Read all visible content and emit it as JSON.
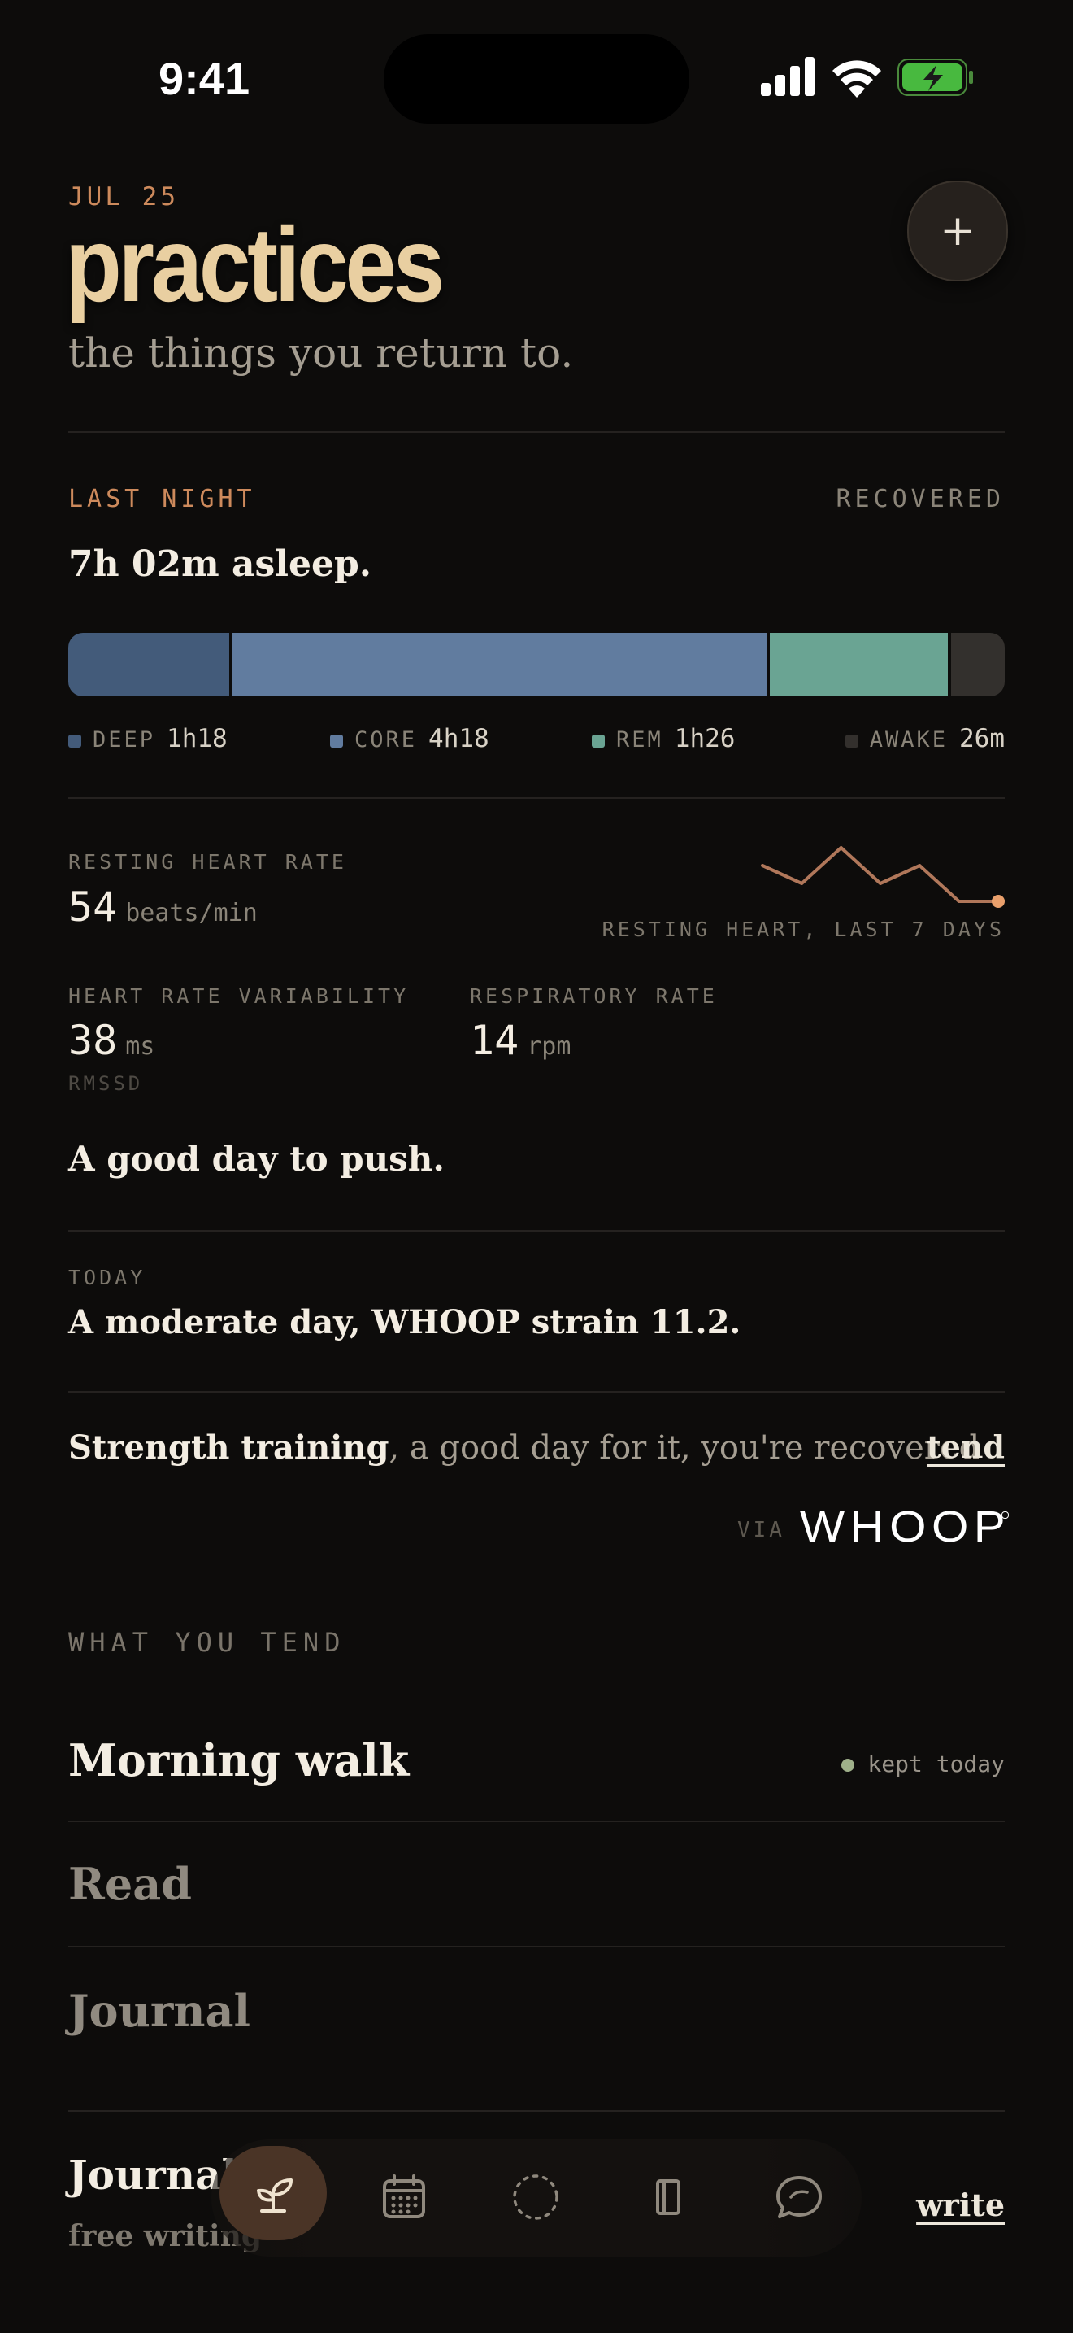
{
  "status": {
    "time": "9:41"
  },
  "header": {
    "date": "JUL 25",
    "title": "practices",
    "subtitle": "the things you return to.",
    "add_label": "+"
  },
  "sleep": {
    "label": "LAST NIGHT",
    "status": "RECOVERED",
    "summary": "7h 02m asleep.",
    "stages": [
      {
        "name": "DEEP",
        "value": "1h18",
        "minutes": 78,
        "color": "#435b7a"
      },
      {
        "name": "CORE",
        "value": "4h18",
        "minutes": 258,
        "color": "#617c9f"
      },
      {
        "name": "REM",
        "value": "1h26",
        "minutes": 86,
        "color": "#6aa493"
      },
      {
        "name": "AWAKE",
        "value": "26m",
        "minutes": 26,
        "color": "#33302d"
      }
    ]
  },
  "heart": {
    "rhr_label": "RESTING HEART RATE",
    "rhr_value": "54",
    "rhr_unit": "beats/min",
    "spark_caption": "RESTING HEART, LAST 7 DAYS",
    "spark_values": [
      57,
      55,
      59,
      55,
      57,
      53,
      53
    ],
    "hrv_label": "HEART RATE VARIABILITY",
    "hrv_value": "38",
    "hrv_unit": "ms",
    "hrv_sub": "RMSSD",
    "resp_label": "RESPIRATORY RATE",
    "resp_value": "14",
    "resp_unit": "rpm",
    "verdict": "A good day to push."
  },
  "today": {
    "label": "TODAY",
    "text": "A moderate day, WHOOP strain 11.2."
  },
  "suggestion": {
    "activity": "Strength training",
    "rest": ", a good day for it, you're recovered",
    "action": "tend",
    "via": "VIA",
    "brand": "WHOOP"
  },
  "tend": {
    "label": "WHAT YOU TEND",
    "items": [
      {
        "title": "Morning walk",
        "status": "kept today"
      },
      {
        "title": "Read"
      },
      {
        "title": "Journal"
      }
    ]
  },
  "journal": {
    "title": "Journal",
    "subtitle": "free writing",
    "action": "write"
  },
  "colors": {
    "accent": "#cd8a5c",
    "title": "#e9cfa1",
    "kept": "#9fb08a"
  },
  "nav": {
    "icons": [
      "sprout-icon",
      "calendar-icon",
      "dotted-circle-icon",
      "book-icon",
      "chat-bubble-icon"
    ]
  }
}
